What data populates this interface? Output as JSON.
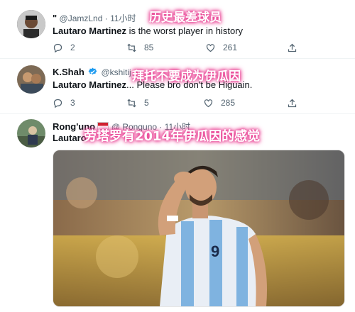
{
  "tweets": [
    {
      "handle": "@JamzLnd",
      "time": "· 11小时",
      "text_bold": "Lautaro Martinez",
      "text_rest": " is the worst player in history",
      "overlay": "历史最差球员",
      "replies": "2",
      "retweets": "85",
      "likes": "261"
    },
    {
      "name": "K.Shah",
      "handle": "@kshitij",
      "text_bold": "Lautaro Martinez",
      "text_rest": "... Please bro don't be Higuain.",
      "overlay": "拜托不要成为伊瓜因",
      "replies": "3",
      "retweets": "5",
      "likes": "285"
    },
    {
      "name": "Rong'uno",
      "handle": "@ Ronguno",
      "time": "· 11小时",
      "text_bold": "Lautaro",
      "overlay": "劳塔罗有2014年伊瓜因的感觉"
    }
  ],
  "colors": {
    "overlay_glow": "#e8398f",
    "verified": "#1d9bf0",
    "muted": "#536471"
  }
}
